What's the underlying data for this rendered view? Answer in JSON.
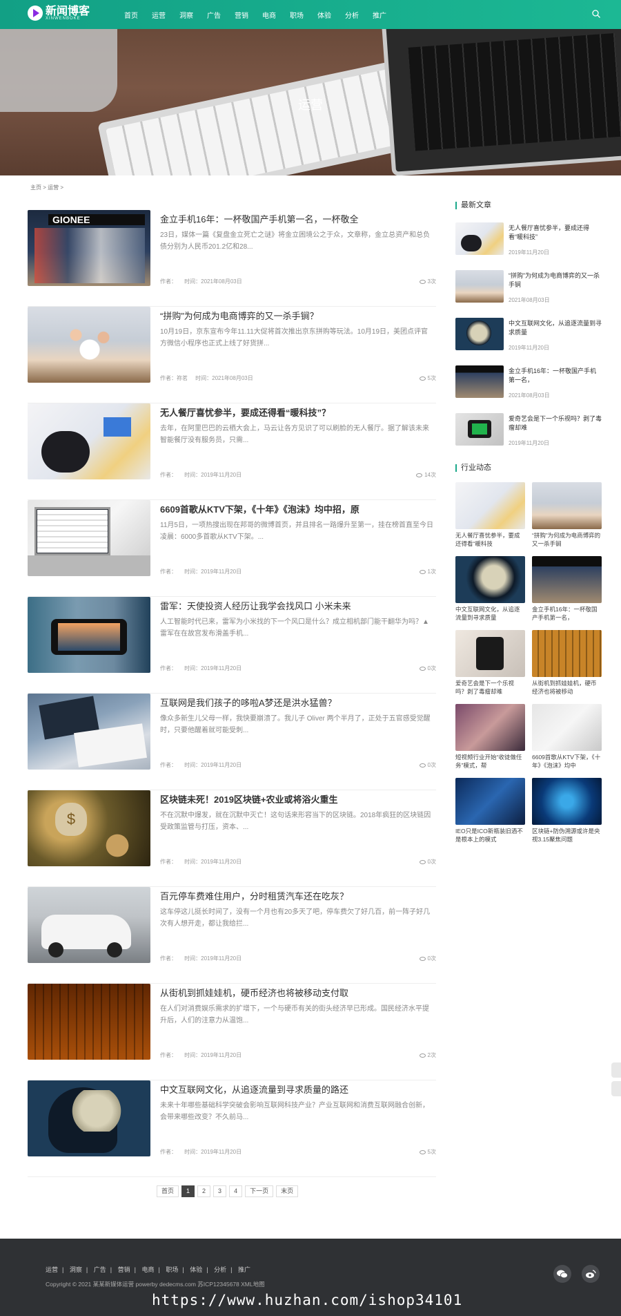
{
  "header": {
    "logo_text": "新闻博客",
    "logo_sub": "XINWENBOKE",
    "nav": [
      "首页",
      "运营",
      "洞察",
      "广告",
      "营销",
      "电商",
      "职场",
      "体验",
      "分析",
      "推广"
    ]
  },
  "banner": {
    "title": "运营"
  },
  "breadcrumb": "主页 > 运营 >",
  "articles": [
    {
      "title": "金立手机16年：一杯敬国产手机第一名，一杯敬全",
      "desc": "23日，媒体一篇《复盘金立死亡之谜》将金立困境公之于众，文章称，金立总资产和总负债分别为人民币201.2亿和28...",
      "author": "作者：",
      "time": "时间：2021年08月03日",
      "views": "3次"
    },
    {
      "title": "“拼购”为何成为电商博弈的又一杀手锏？",
      "desc": "10月19日，京东宣布今年11.11大促将首次推出京东拼购等玩法。10月19日，美团点评官方微信小程序也正式上线了好货拼...",
      "author": "作者：祢茗",
      "time": "时间：2021年08月03日",
      "views": "5次"
    },
    {
      "title": "无人餐厅喜忧参半，要成还得看“暖科技”？",
      "desc": "去年，在阿里巴巴的云栖大会上，马云让各方见识了可以刷脸的无人餐厅。据了解该未来智能餐厅没有服务员，只需...",
      "author": "作者：",
      "time": "时间：2019年11月20日",
      "views": "14次"
    },
    {
      "title": "6609首歌从KTV下架，《十年》《泡沫》均中招，原",
      "desc": "11月5日，一项热搜出现在邦哥的微博首页，并且排名一路爆升至第一，挂在榜首直至今日凌晨：6000多首歌从KTV下架。...",
      "author": "作者：",
      "time": "时间：2019年11月20日",
      "views": "1次"
    },
    {
      "title": "雷军：天使投资人经历让我学会找风口 小米未来",
      "desc": "人工智能时代已来，雷军为小米找的下一个风口是什么？成立相机部门能干翻华为吗？▲雷军在在故宫发布滑盖手机...",
      "author": "作者：",
      "time": "时间：2019年11月20日",
      "views": "0次"
    },
    {
      "title": "互联网是我们孩子的哆啦A梦还是洪水猛兽？",
      "desc": "像众多新生儿父母一样，我快要崩溃了。我儿子 Oliver 两个半月了，正处于五官感受觉醒时，只要他醒着就可能受刺...",
      "author": "作者：",
      "time": "时间：2019年11月20日",
      "views": "0次"
    },
    {
      "title": "区块链未死！2019区块链+农业或将浴火重生",
      "desc": "不在沉默中爆发，就在沉默中灭亡！这句话来形容当下的区块链。2018年疯狂的区块链因受政策监管与打压，资本、...",
      "author": "作者：",
      "time": "时间：2019年11月20日",
      "views": "0次"
    },
    {
      "title": "百元停车费难住用户，分时租赁汽车还在吃灰？",
      "desc": "这车停这儿挺长时间了，没有一个月也有20多天了吧，停车费欠了好几百，前一阵子好几次有人想开走，都让我给拦...",
      "author": "作者：",
      "time": "时间：2019年11月20日",
      "views": "0次"
    },
    {
      "title": "从街机到抓娃娃机，硬币经济也将被移动支付取",
      "desc": "在人们对消费娱乐需求的扩增下，一个与硬币有关的街头经济早已形成。国民经济水平提升后，人们的注意力从温饱...",
      "author": "作者：",
      "time": "时间：2019年11月20日",
      "views": "2次"
    },
    {
      "title": "中文互联网文化，从追逐流量到寻求质量的路还",
      "desc": "未来十年哪些基础科学突破会影响互联网科技产业？产业互联网和消费互联网融合创新，会带来哪些改变？不久前马...",
      "author": "作者：",
      "time": "时间：2019年11月20日",
      "views": "5次"
    }
  ],
  "pager": [
    "首页",
    "1",
    "2",
    "3",
    "4",
    "下一页",
    "末页"
  ],
  "sidebar": {
    "latest_title": "最新文章",
    "latest": [
      {
        "title": "无人餐厅喜忧参半，要成还得看“暖科技”",
        "date": "2019年11月20日"
      },
      {
        "title": "“拼购”为何成为电商博弈的又一杀手锏",
        "date": "2021年08月03日"
      },
      {
        "title": "中文互联网文化，从追逐流量到寻求质量",
        "date": "2019年11月20日"
      },
      {
        "title": "金立手机16年：一杯敬国产手机第一名，",
        "date": "2021年08月03日"
      },
      {
        "title": "爱奇艺会是下一个乐视吗？剥了毒瘤却难",
        "date": "2019年11月20日"
      }
    ],
    "industry_title": "行业动态",
    "industry": [
      "无人餐厅喜忧参半，要成还得看“暖科技",
      "“拼购”为何成为电商博弈的又一杀手锏",
      "中文互联网文化，从追逐流量到寻求质量",
      "金立手机16年：一杯敬国产手机第一名，",
      "爱奇艺会是下一个乐视吗？剥了毒瘤却难",
      "从街机到抓娃娃机，硬币经济也将被移动",
      "短视频行业开始“收徒做任务”模式，帮",
      "6609首歌从KTV下架，《十年》《泡沫》均中",
      "IEO只是ICO新瓶装旧酒不是根本上的模式",
      "区块链+防伪溯源或许是央视3.15聚焦问题"
    ]
  },
  "footer": {
    "nav": [
      "运营",
      "洞察",
      "广告",
      "营销",
      "电商",
      "职场",
      "体验",
      "分析",
      "推广"
    ],
    "copyright": "Copyright © 2021 某某新媒体运营 powerby dedecms.com 苏ICP12345678 XML地图"
  },
  "watermark": "https://www.huzhan.com/ishop34101",
  "colors": {
    "brand": "#1aa88a",
    "footer_bg": "#2f3134"
  }
}
